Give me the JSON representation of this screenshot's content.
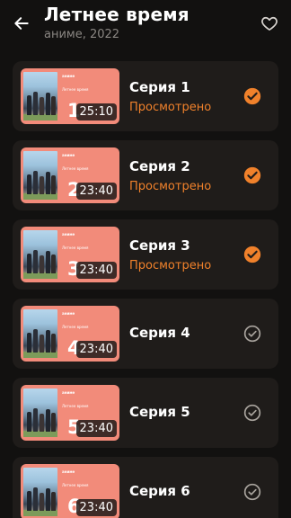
{
  "header": {
    "title": "Летнее время",
    "subtitle": "аниме, 2022"
  },
  "thumb_text": {
    "kind": "аниме",
    "name": "Летнее время"
  },
  "colors": {
    "accent": "#f0812b",
    "thumb_bg": "#f28b7a",
    "card_bg": "#1f1c1a",
    "page_bg": "#121110",
    "check_inactive": "#a8a39d"
  },
  "icons": {
    "back": "arrow-left-icon",
    "favorite": "heart-outline-icon",
    "watched": "check-circle-filled-icon",
    "unwatched": "check-circle-outline-icon"
  },
  "episodes": [
    {
      "number": "1",
      "title": "Серия 1",
      "duration": "25:10",
      "status": "Просмотрено",
      "watched": true
    },
    {
      "number": "2",
      "title": "Серия 2",
      "duration": "23:40",
      "status": "Просмотрено",
      "watched": true
    },
    {
      "number": "3",
      "title": "Серия 3",
      "duration": "23:40",
      "status": "Просмотрено",
      "watched": true
    },
    {
      "number": "4",
      "title": "Серия 4",
      "duration": "23:40",
      "status": "",
      "watched": false
    },
    {
      "number": "5",
      "title": "Серия 5",
      "duration": "23:40",
      "status": "",
      "watched": false
    },
    {
      "number": "6",
      "title": "Серия 6",
      "duration": "23:40",
      "status": "",
      "watched": false
    }
  ]
}
